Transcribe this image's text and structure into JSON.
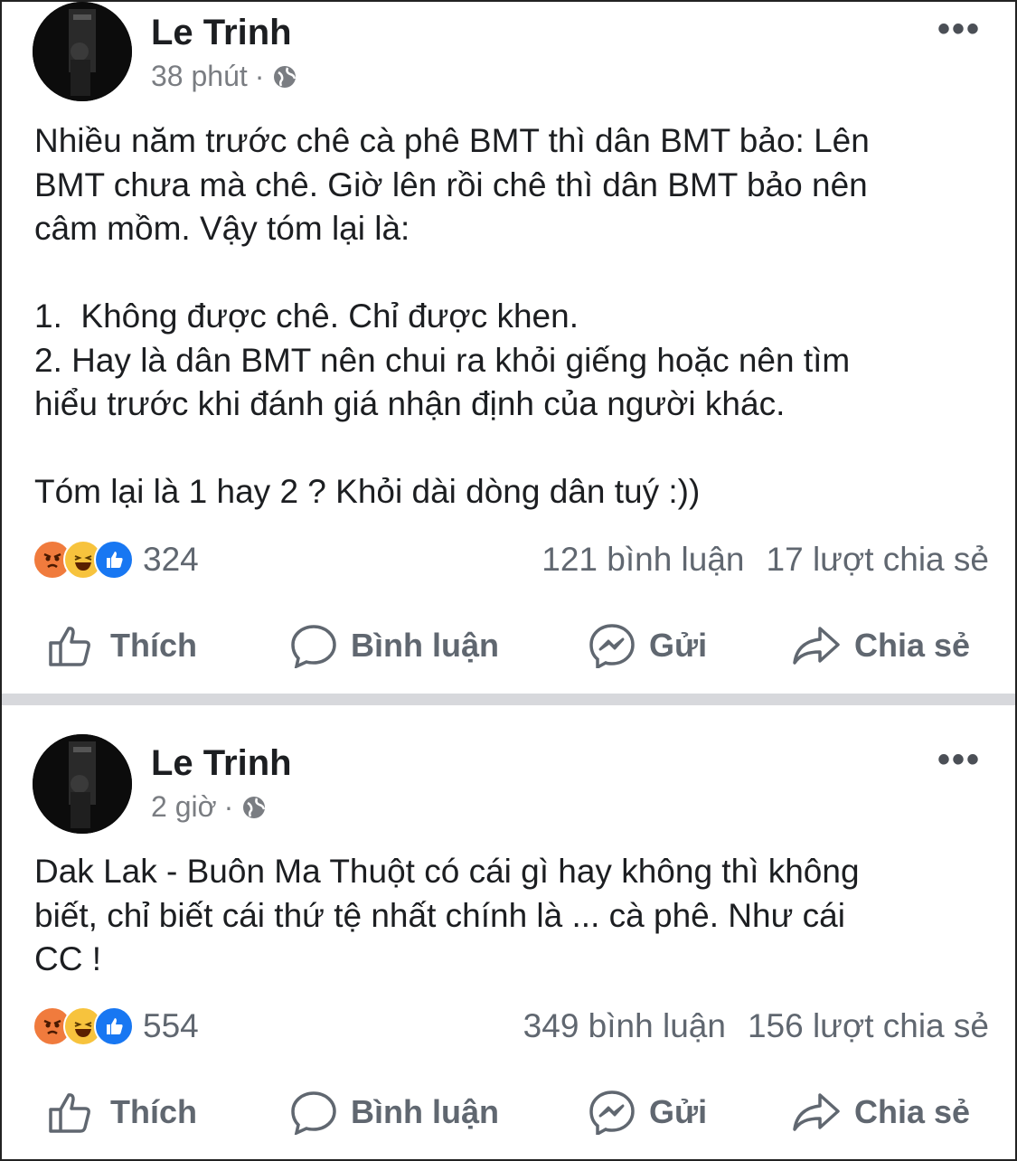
{
  "posts": [
    {
      "author": "Le Trinh",
      "time": "38 phút",
      "dot": "·",
      "more": "•••",
      "text": "Nhiều năm trước chê cà phê BMT thì dân BMT bảo: Lên\nBMT chưa mà chê. Giờ lên rồi chê thì dân BMT bảo nên\ncâm mồm. Vậy tóm lại là:\n\n1.  Không được chê. Chỉ được khen.\n2. Hay là dân BMT nên chui ra khỏi giếng hoặc nên tìm\nhiểu trước khi đánh giá nhận định của người khác.\n\nTóm lại là 1 hay 2 ? Khỏi dài dòng dân tuý :))",
      "reaction_count": "324",
      "comments": "121 bình luận",
      "shares": "17 lượt chia sẻ"
    },
    {
      "author": "Le Trinh",
      "time": "2 giờ",
      "dot": "·",
      "more": "•••",
      "text": "Dak Lak - Buôn Ma Thuột có cái gì hay không thì không\nbiết, chỉ biết cái thứ tệ nhất chính là ... cà phê. Như cái\nCC !",
      "reaction_count": "554",
      "comments": "349 bình luận",
      "shares": "156 lượt chia sẻ"
    }
  ],
  "actions": {
    "like": "Thích",
    "comment": "Bình luận",
    "send": "Gửi",
    "share": "Chia sẻ"
  },
  "colors": {
    "text": "#1c1e21",
    "muted": "#606770",
    "like_blue": "#1877f2",
    "angry": "#f07b3d",
    "haha": "#f7c33d",
    "divider": "#d7d8dc"
  }
}
